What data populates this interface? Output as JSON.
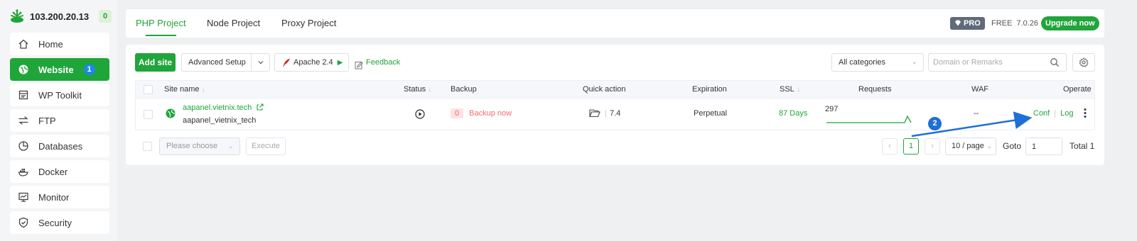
{
  "server": {
    "ip": "103.200.20.13",
    "count": "0"
  },
  "sidebar": {
    "items": [
      {
        "label": "Home",
        "icon": "home-icon"
      },
      {
        "label": "Website",
        "icon": "globe-icon",
        "badge": "1",
        "active": true
      },
      {
        "label": "WP Toolkit",
        "icon": "wp-toolkit-icon"
      },
      {
        "label": "FTP",
        "icon": "ftp-arrows-icon"
      },
      {
        "label": "Databases",
        "icon": "database-icon"
      },
      {
        "label": "Docker",
        "icon": "docker-icon"
      },
      {
        "label": "Monitor",
        "icon": "monitor-icon"
      },
      {
        "label": "Security",
        "icon": "shield-icon"
      }
    ]
  },
  "tabs": [
    {
      "label": "PHP Project",
      "active": true
    },
    {
      "label": "Node Project"
    },
    {
      "label": "Proxy Project"
    }
  ],
  "license": {
    "pro": "PRO",
    "free": "FREE",
    "version": "7.0.26",
    "upgrade": "Upgrade now"
  },
  "toolbar": {
    "add_site": "Add site",
    "advanced_setup": "Advanced Setup",
    "apache": "Apache 2.4",
    "feedback": "Feedback",
    "category": "All categories",
    "search_placeholder": "Domain or Remarks"
  },
  "table": {
    "headers": {
      "site_name": "Site name",
      "status": "Status",
      "backup": "Backup",
      "quick_action": "Quick action",
      "expiration": "Expiration",
      "ssl": "SSL",
      "requests": "Requests",
      "waf": "WAF",
      "operate": "Operate"
    },
    "rows": [
      {
        "domain": "aapanel.vietnix.tech",
        "remark": "aapanel_vietnix_tech",
        "backup_count": "0",
        "backup_action": "Backup now",
        "php_version": "7.4",
        "expiration": "Perpetual",
        "ssl": "87 Days",
        "requests": "297",
        "waf": "--",
        "conf": "Conf",
        "log": "Log"
      }
    ]
  },
  "footer": {
    "choose": "Please choose",
    "execute": "Execute",
    "current_page": "1",
    "per_page": "10 / page",
    "goto_label": "Goto",
    "goto_value": "1",
    "total": "Total 1"
  },
  "annotation": {
    "marker": "2",
    "color": "#1e6fd9"
  },
  "colors": {
    "brand": "#20a53a",
    "danger": "#f56c6c",
    "badge_blue": "#1e88e5"
  }
}
